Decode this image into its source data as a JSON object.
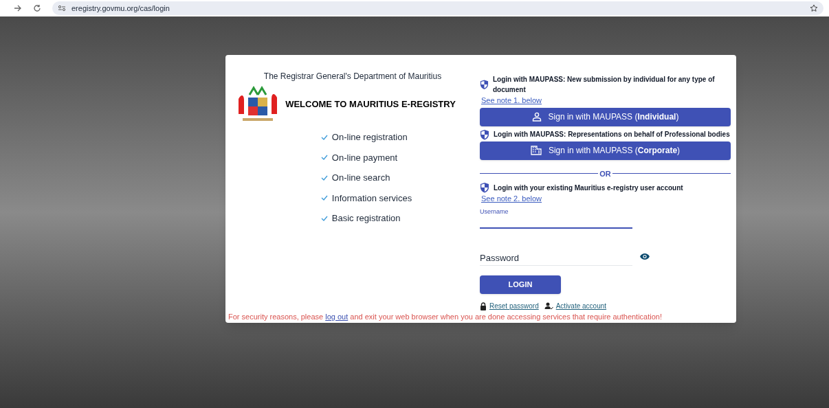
{
  "browser": {
    "url": "eregistry.govmu.org/cas/login"
  },
  "left": {
    "department": "The Registrar General's Department of Mauritius",
    "welcome": "WELCOME TO MAURITIUS E-REGISTRY",
    "features": [
      "On-line registration",
      "On-line payment",
      "On-line search",
      "Information services",
      "Basic registration"
    ]
  },
  "right": {
    "sections": [
      {
        "heading": "Login with MAUPASS: New submission by individual for any type of document",
        "note": "See note 1. below",
        "button": {
          "kind": "person",
          "label": "Sign in with MAUPASS (**Individual**)"
        }
      },
      {
        "heading": "Login with MAUPASS: Representations on behalf of Professional bodies",
        "button": {
          "kind": "building",
          "label": "Sign in with MAUPASS (**Corporate**)"
        }
      }
    ],
    "divider": "OR",
    "account": {
      "heading": "Login with your existing Mauritius e-registry user account",
      "note": "See note 2. below"
    },
    "username": {
      "label": "Username"
    },
    "password": {
      "placeholder": "Password"
    },
    "login_button": "LOGIN",
    "links": [
      {
        "kind": "lock",
        "label": "Reset password"
      },
      {
        "kind": "user-check",
        "label": "Activate account"
      }
    ]
  },
  "notice": {
    "before": "For security reasons, please",
    "link": "log out",
    "after": "and exit your web browser when you are done accessing services that require authentication!"
  }
}
